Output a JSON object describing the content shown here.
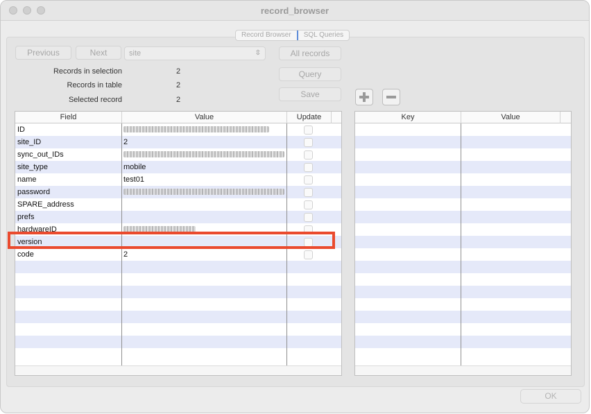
{
  "window": {
    "title": "record_browser"
  },
  "tabs": [
    "Record Browser",
    "SQL Queries"
  ],
  "toolbar": {
    "previous_label": "Previous",
    "next_label": "Next",
    "select_value": "site",
    "all_records_label": "All records",
    "query_label": "Query",
    "save_label": "Save"
  },
  "info": {
    "in_selection_label": "Records in selection",
    "in_selection_value": "2",
    "in_table_label": "Records in table",
    "in_table_value": "2",
    "selected_label": "Selected record",
    "selected_value": "2"
  },
  "record_table": {
    "columns": [
      "Field",
      "Value",
      "Update"
    ],
    "rows": [
      {
        "field": "ID",
        "value": "",
        "redacted": true
      },
      {
        "field": "site_ID",
        "value": "2",
        "redacted": false
      },
      {
        "field": "sync_out_IDs",
        "value": "",
        "redacted": true
      },
      {
        "field": "site_type",
        "value": "mobile",
        "redacted": false
      },
      {
        "field": "name",
        "value": "test01",
        "redacted": false
      },
      {
        "field": "password",
        "value": "",
        "redacted": true
      },
      {
        "field": "SPARE_address",
        "value": "",
        "redacted": false
      },
      {
        "field": "prefs",
        "value": "",
        "redacted": false
      },
      {
        "field": "hardwareID",
        "value": "",
        "redacted": true
      },
      {
        "field": "version",
        "value": "",
        "redacted": false
      },
      {
        "field": "code",
        "value": "2",
        "redacted": false
      }
    ]
  },
  "kv_table": {
    "columns": [
      "Key",
      "Value"
    ]
  },
  "footer": {
    "ok_label": "OK"
  },
  "colors": {
    "highlight": "#ea4a2e",
    "stripe": "#e5e9f9",
    "tab_divider": "#5a8ad8"
  }
}
